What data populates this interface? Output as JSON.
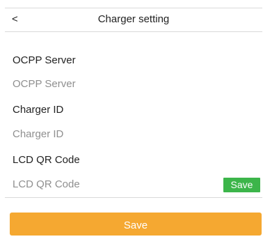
{
  "header": {
    "back_label": "<",
    "title": "Charger setting"
  },
  "form": {
    "ocpp_server": {
      "label": "OCPP Server",
      "placeholder": "OCPP Server"
    },
    "charger_id": {
      "label": "Charger ID",
      "placeholder": "Charger ID"
    },
    "lcd_qr_code": {
      "label": "LCD QR Code",
      "placeholder": "LCD QR Code",
      "save_label": "Save"
    }
  },
  "footer": {
    "save_label": "Save"
  },
  "colors": {
    "accent_orange": "#f5a831",
    "save_green": "#3cb54a",
    "placeholder_gray": "#8f8f8f",
    "divider": "#d9d9d9"
  }
}
